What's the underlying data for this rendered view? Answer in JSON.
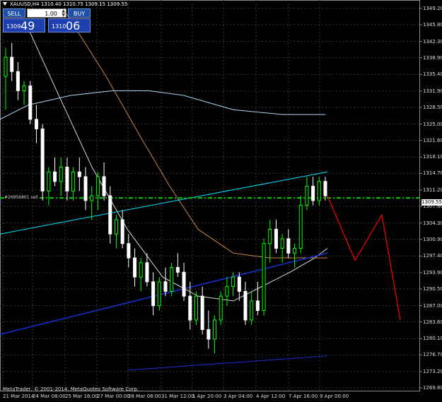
{
  "header": {
    "symbol_info": "XAUUSD,H4  1310.40 1310.75 1309.15 1309.55"
  },
  "trade_panel": {
    "sell_label": "SELL",
    "buy_label": "BUY",
    "lot_value": "1.00",
    "bid_small": "1309",
    "bid_big": "49",
    "ask_small": "1310",
    "ask_big": "06"
  },
  "line_label": "#26956801 sell",
  "current_price": "1309.55",
  "copyright": "MetaTrader, © 2001-2014, MetaQuotes Software Corp.",
  "y_axis": [
    "1349.20",
    "1345.80",
    "1342.30",
    "1338.90",
    "1335.40",
    "1331.90",
    "1328.50",
    "1325.00",
    "1321.60",
    "1318.10",
    "1314.70",
    "1311.20",
    "1307.80",
    "1304.30",
    "1300.90",
    "1297.40",
    "1293.90",
    "1290.50",
    "1287.00",
    "1283.60",
    "1280.10",
    "1276.70",
    "1273.20",
    "1269.80"
  ],
  "x_axis": [
    "21 Mar 2014",
    "24 Mar 08:00",
    "25 Mar 16:00",
    "27 Mar 00:00",
    "28 Mar 08:00",
    "31 Mar 12:00",
    "1 Apr 20:00",
    "3 Apr 04:00",
    "4 Apr 12:00",
    "7 Apr 16:00",
    "9 Apr 00:00"
  ],
  "colors": {
    "background": "#000000",
    "grid": "#3a3a3a",
    "bull_candle": "#00ff00",
    "bear_candle": "#ffffff",
    "order_line": "#00cc00",
    "projection": "#ff0000",
    "channel_cyan": "#00e5ff",
    "channel_blue": "#1a2fd8",
    "ma_orange": "#c8864a",
    "ma_lightblue": "#a9d8ee",
    "ma_white": "#d8d8d8"
  },
  "chart_data": {
    "type": "candlestick",
    "symbol": "XAUUSD",
    "timeframe": "H4",
    "ylim": [
      1269.8,
      1349.2
    ],
    "open": 1310.4,
    "high": 1310.75,
    "low": 1309.15,
    "close": 1309.55,
    "order_line_price": 1309.55,
    "candles": [
      [
        1335,
        1341,
        1328,
        1339
      ],
      [
        1339,
        1342,
        1334,
        1336
      ],
      [
        1336,
        1338,
        1330,
        1332
      ],
      [
        1332,
        1334,
        1329,
        1333
      ],
      [
        1333,
        1334,
        1325,
        1326
      ],
      [
        1326,
        1329,
        1321,
        1324
      ],
      [
        1324,
        1325,
        1309,
        1311
      ],
      [
        1311,
        1316,
        1308,
        1315
      ],
      [
        1315,
        1318,
        1312,
        1313
      ],
      [
        1313,
        1318,
        1310,
        1316
      ],
      [
        1316,
        1318,
        1309,
        1311
      ],
      [
        1311,
        1316,
        1309,
        1315
      ],
      [
        1315,
        1318,
        1311,
        1314
      ],
      [
        1314,
        1316,
        1307,
        1309
      ],
      [
        1309,
        1312,
        1305,
        1310
      ],
      [
        1310,
        1315,
        1307,
        1314
      ],
      [
        1314,
        1317,
        1309,
        1310
      ],
      [
        1310,
        1312,
        1300,
        1302
      ],
      [
        1302,
        1306,
        1299,
        1305
      ],
      [
        1305,
        1307,
        1299,
        1300
      ],
      [
        1300,
        1302,
        1295,
        1297
      ],
      [
        1297,
        1299,
        1291,
        1293
      ],
      [
        1293,
        1297,
        1290,
        1296
      ],
      [
        1296,
        1298,
        1291,
        1292
      ],
      [
        1292,
        1294,
        1285,
        1287
      ],
      [
        1287,
        1293,
        1286,
        1292
      ],
      [
        1292,
        1295,
        1289,
        1290
      ],
      [
        1290,
        1296,
        1289,
        1295
      ],
      [
        1295,
        1298,
        1293,
        1294
      ],
      [
        1294,
        1296,
        1288,
        1289
      ],
      [
        1289,
        1292,
        1282,
        1284
      ],
      [
        1284,
        1290,
        1283,
        1289
      ],
      [
        1289,
        1291,
        1281,
        1282
      ],
      [
        1282,
        1286,
        1278,
        1280
      ],
      [
        1280,
        1285,
        1277,
        1284
      ],
      [
        1284,
        1290,
        1283,
        1289
      ],
      [
        1289,
        1293,
        1287,
        1291
      ],
      [
        1291,
        1294,
        1289,
        1293
      ],
      [
        1293,
        1294,
        1288,
        1290
      ],
      [
        1290,
        1292,
        1283,
        1284
      ],
      [
        1284,
        1290,
        1283,
        1288
      ],
      [
        1288,
        1292,
        1285,
        1286
      ],
      [
        1286,
        1301,
        1285,
        1300
      ],
      [
        1300,
        1305,
        1296,
        1303
      ],
      [
        1303,
        1305,
        1298,
        1299
      ],
      [
        1299,
        1302,
        1296,
        1301
      ],
      [
        1301,
        1303,
        1297,
        1298
      ],
      [
        1298,
        1300,
        1295,
        1299
      ],
      [
        1299,
        1310,
        1298,
        1308
      ],
      [
        1308,
        1314,
        1307,
        1312
      ],
      [
        1312,
        1314,
        1308,
        1309
      ],
      [
        1309,
        1314,
        1308,
        1313
      ],
      [
        1313,
        1314,
        1309,
        1310
      ]
    ],
    "projection": [
      [
        1310.0,
        "9 Apr 00:00"
      ],
      [
        1296.5,
        "p1"
      ],
      [
        1306.0,
        "p2"
      ],
      [
        1284.0,
        "p3"
      ]
    ]
  }
}
